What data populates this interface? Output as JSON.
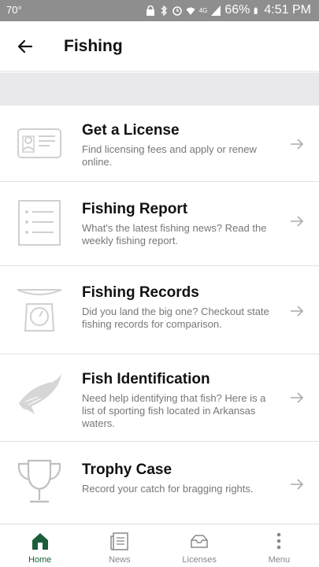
{
  "status_bar": {
    "temperature": "70°",
    "battery": "66%",
    "time": "4:51 PM",
    "network": "4G"
  },
  "header": {
    "title": "Fishing"
  },
  "items": [
    {
      "title": "Get a License",
      "description": "Find licensing fees and apply or renew online.",
      "icon": "license-card-icon"
    },
    {
      "title": "Fishing Report",
      "description": "What's the latest fishing news? Read the weekly fishing report.",
      "icon": "report-list-icon"
    },
    {
      "title": "Fishing Records",
      "description": "Did you land the big one? Checkout state fishing records for comparison.",
      "icon": "scale-icon"
    },
    {
      "title": "Fish Identification",
      "description": "Need help identifying that fish? Here is a list of sporting fish located in Arkansas waters.",
      "icon": "fish-icon"
    },
    {
      "title": "Trophy Case",
      "description": "Record your catch for bragging rights.",
      "icon": "trophy-icon"
    }
  ],
  "bottom_nav": [
    {
      "label": "Home",
      "icon": "home-icon",
      "active": true
    },
    {
      "label": "News",
      "icon": "news-icon",
      "active": false
    },
    {
      "label": "Licenses",
      "icon": "licenses-icon",
      "active": false
    },
    {
      "label": "Menu",
      "icon": "menu-dots-icon",
      "active": false
    }
  ],
  "colors": {
    "accent": "#1b5e3a",
    "status_bar": "#8e8e8e",
    "icon_gray": "#c8c8c8"
  }
}
